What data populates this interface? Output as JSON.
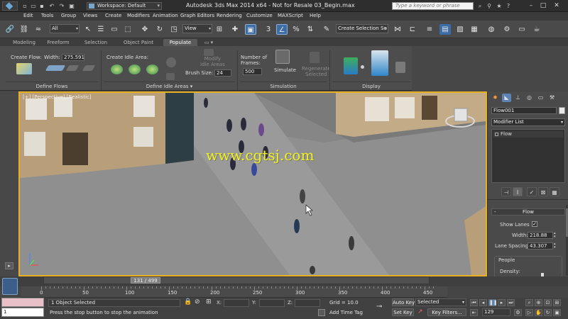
{
  "title": {
    "workspace": "Workspace: Default",
    "app_title": "Autodesk 3ds Max  2014 x64  - Not for Resale   03_Begin.max",
    "search_placeholder": "Type a keyword or phrase"
  },
  "menu": [
    "Edit",
    "Tools",
    "Group",
    "Views",
    "Create",
    "Modifiers",
    "Animation",
    "Graph Editors",
    "Rendering",
    "Customize",
    "MAXScript",
    "Help"
  ],
  "toolbar": {
    "filter_value": "All",
    "refcoord_value": "View",
    "snap_label": "3",
    "named_selection": "Create Selection Se"
  },
  "ribbon": {
    "tabs": [
      "Modeling",
      "Freeform",
      "Selection",
      "Object Paint",
      "Populate"
    ],
    "active_tab": "Populate",
    "create_flow_label": "Create Flow:",
    "width_label": "Width:",
    "width_value": "275.591",
    "create_idle_label": "Create Idle Area:",
    "modify_idle_label": "Modify\nIdle Areas",
    "brush_size_label": "Brush Size:",
    "brush_size_value": "24",
    "frames_label": "Number of\nFrames:",
    "frames_value": "500",
    "simulate_label": "Simulate",
    "regenerate_label": "Regenerate\nSelected",
    "footer_define_flows": "Define Flows",
    "footer_define_idle": "Define Idle Areas ▾",
    "footer_simulation": "Simulation",
    "footer_display": "Display"
  },
  "viewport": {
    "label": "[+] [Perspective] [Realistic]",
    "watermark": "www.cgtsj.com"
  },
  "command_panel": {
    "object_name": "Flow001",
    "modifier_list": "Modifier List",
    "stack_item": "Flow",
    "rollout_title": "Flow",
    "show_lanes_label": "Show Lanes",
    "show_lanes_checked": true,
    "width_label": "Width:",
    "width_value": "218.88",
    "lane_spacing_label": "Lane Spacing:",
    "lane_spacing_value": "43.307",
    "people_label": "People",
    "density_label": "Density:"
  },
  "timeline": {
    "slider_label": "131 / 499",
    "ticks": [
      "0",
      "50",
      "100",
      "150",
      "200",
      "250",
      "300",
      "350",
      "400",
      "450"
    ]
  },
  "status": {
    "selection": "1 Object Selected",
    "prompt": "Press the stop button to stop the animation",
    "maxscript_value": "1",
    "x_label": "X:",
    "y_label": "Y:",
    "z_label": "Z:",
    "grid": "Grid = 10.0",
    "add_time_tag": "Add Time Tag",
    "auto_key": "Auto Key",
    "set_key": "Set Key",
    "selected_value": "Selected",
    "key_filters": "Key Filters...",
    "frame_value": "129"
  },
  "colors": {
    "viewport_border": "#e8b021",
    "watermark": "#f2f21a",
    "accent": "#5b84b5"
  }
}
